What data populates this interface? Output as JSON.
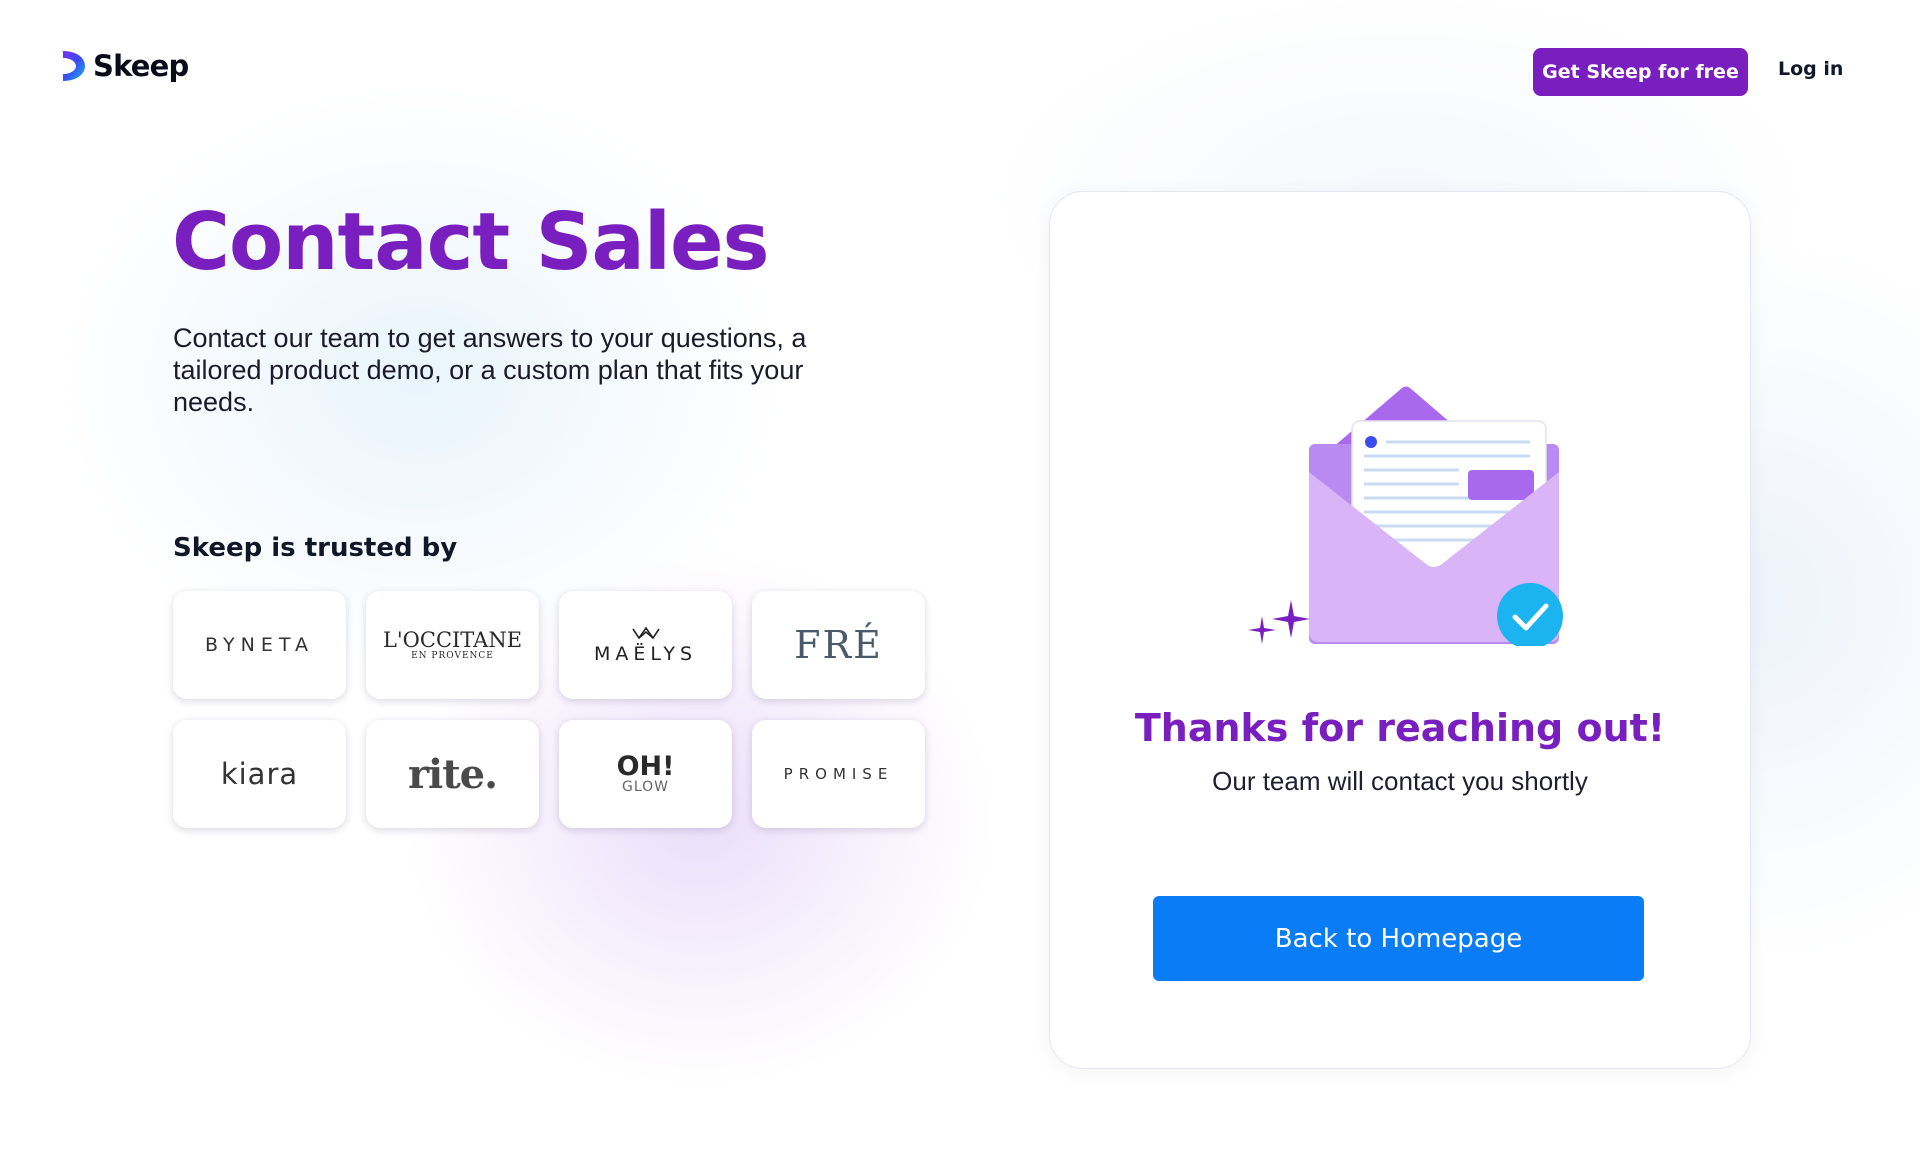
{
  "header": {
    "brand_name": "Skeep",
    "cta_label": "Get Skeep for free",
    "login_label": "Log in"
  },
  "hero": {
    "title": "Contact Sales",
    "intro": "Contact our team to get answers to your questions, a tailored product demo, or a custom plan that fits your needs."
  },
  "trusted": {
    "heading": "Skeep is trusted by",
    "logos": [
      {
        "name": "BYNETA"
      },
      {
        "name": "L'OCCITANE",
        "sub": "EN PROVENCE"
      },
      {
        "name": "MAËLYS"
      },
      {
        "name": "FRÉ"
      },
      {
        "name": "kiara"
      },
      {
        "name": "rite."
      },
      {
        "name": "OH!",
        "sub": "GLOW"
      },
      {
        "name": "PROMISE"
      }
    ]
  },
  "confirmation": {
    "heading": "Thanks for reaching out!",
    "subtext": "Our team will contact you shortly",
    "button_label": "Back to Homepage"
  },
  "colors": {
    "brand_purple": "#7a1fbf",
    "button_blue": "#0a7cf6",
    "envelope_light": "#d9b4f7",
    "envelope_dark": "#a869ee",
    "check_cyan": "#1cb4f0"
  },
  "icons": {
    "logo": "skeep-logo-icon",
    "envelope": "envelope-letter-icon",
    "check": "check-circle-icon",
    "sparkles": "sparkle-icon",
    "crown": "crown-icon"
  }
}
